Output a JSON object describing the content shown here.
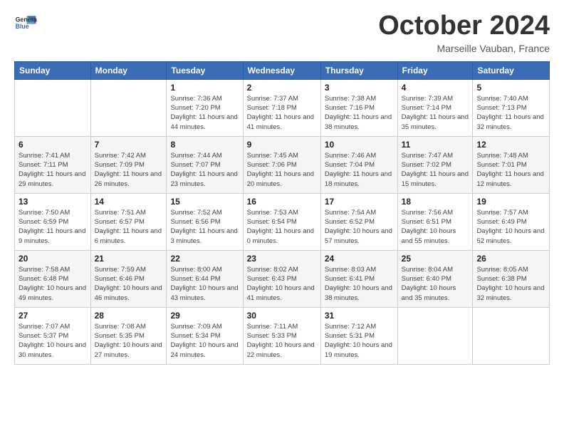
{
  "logo": {
    "line1": "General",
    "line2": "Blue"
  },
  "title": "October 2024",
  "location": "Marseille Vauban, France",
  "days_of_week": [
    "Sunday",
    "Monday",
    "Tuesday",
    "Wednesday",
    "Thursday",
    "Friday",
    "Saturday"
  ],
  "weeks": [
    [
      {
        "day": "",
        "sunrise": "",
        "sunset": "",
        "daylight": ""
      },
      {
        "day": "",
        "sunrise": "",
        "sunset": "",
        "daylight": ""
      },
      {
        "day": "1",
        "sunrise": "Sunrise: 7:36 AM",
        "sunset": "Sunset: 7:20 PM",
        "daylight": "Daylight: 11 hours and 44 minutes."
      },
      {
        "day": "2",
        "sunrise": "Sunrise: 7:37 AM",
        "sunset": "Sunset: 7:18 PM",
        "daylight": "Daylight: 11 hours and 41 minutes."
      },
      {
        "day": "3",
        "sunrise": "Sunrise: 7:38 AM",
        "sunset": "Sunset: 7:16 PM",
        "daylight": "Daylight: 11 hours and 38 minutes."
      },
      {
        "day": "4",
        "sunrise": "Sunrise: 7:39 AM",
        "sunset": "Sunset: 7:14 PM",
        "daylight": "Daylight: 11 hours and 35 minutes."
      },
      {
        "day": "5",
        "sunrise": "Sunrise: 7:40 AM",
        "sunset": "Sunset: 7:13 PM",
        "daylight": "Daylight: 11 hours and 32 minutes."
      }
    ],
    [
      {
        "day": "6",
        "sunrise": "Sunrise: 7:41 AM",
        "sunset": "Sunset: 7:11 PM",
        "daylight": "Daylight: 11 hours and 29 minutes."
      },
      {
        "day": "7",
        "sunrise": "Sunrise: 7:42 AM",
        "sunset": "Sunset: 7:09 PM",
        "daylight": "Daylight: 11 hours and 26 minutes."
      },
      {
        "day": "8",
        "sunrise": "Sunrise: 7:44 AM",
        "sunset": "Sunset: 7:07 PM",
        "daylight": "Daylight: 11 hours and 23 minutes."
      },
      {
        "day": "9",
        "sunrise": "Sunrise: 7:45 AM",
        "sunset": "Sunset: 7:06 PM",
        "daylight": "Daylight: 11 hours and 20 minutes."
      },
      {
        "day": "10",
        "sunrise": "Sunrise: 7:46 AM",
        "sunset": "Sunset: 7:04 PM",
        "daylight": "Daylight: 11 hours and 18 minutes."
      },
      {
        "day": "11",
        "sunrise": "Sunrise: 7:47 AM",
        "sunset": "Sunset: 7:02 PM",
        "daylight": "Daylight: 11 hours and 15 minutes."
      },
      {
        "day": "12",
        "sunrise": "Sunrise: 7:48 AM",
        "sunset": "Sunset: 7:01 PM",
        "daylight": "Daylight: 11 hours and 12 minutes."
      }
    ],
    [
      {
        "day": "13",
        "sunrise": "Sunrise: 7:50 AM",
        "sunset": "Sunset: 6:59 PM",
        "daylight": "Daylight: 11 hours and 9 minutes."
      },
      {
        "day": "14",
        "sunrise": "Sunrise: 7:51 AM",
        "sunset": "Sunset: 6:57 PM",
        "daylight": "Daylight: 11 hours and 6 minutes."
      },
      {
        "day": "15",
        "sunrise": "Sunrise: 7:52 AM",
        "sunset": "Sunset: 6:56 PM",
        "daylight": "Daylight: 11 hours and 3 minutes."
      },
      {
        "day": "16",
        "sunrise": "Sunrise: 7:53 AM",
        "sunset": "Sunset: 6:54 PM",
        "daylight": "Daylight: 11 hours and 0 minutes."
      },
      {
        "day": "17",
        "sunrise": "Sunrise: 7:54 AM",
        "sunset": "Sunset: 6:52 PM",
        "daylight": "Daylight: 10 hours and 57 minutes."
      },
      {
        "day": "18",
        "sunrise": "Sunrise: 7:56 AM",
        "sunset": "Sunset: 6:51 PM",
        "daylight": "Daylight: 10 hours and 55 minutes."
      },
      {
        "day": "19",
        "sunrise": "Sunrise: 7:57 AM",
        "sunset": "Sunset: 6:49 PM",
        "daylight": "Daylight: 10 hours and 52 minutes."
      }
    ],
    [
      {
        "day": "20",
        "sunrise": "Sunrise: 7:58 AM",
        "sunset": "Sunset: 6:48 PM",
        "daylight": "Daylight: 10 hours and 49 minutes."
      },
      {
        "day": "21",
        "sunrise": "Sunrise: 7:59 AM",
        "sunset": "Sunset: 6:46 PM",
        "daylight": "Daylight: 10 hours and 46 minutes."
      },
      {
        "day": "22",
        "sunrise": "Sunrise: 8:00 AM",
        "sunset": "Sunset: 6:44 PM",
        "daylight": "Daylight: 10 hours and 43 minutes."
      },
      {
        "day": "23",
        "sunrise": "Sunrise: 8:02 AM",
        "sunset": "Sunset: 6:43 PM",
        "daylight": "Daylight: 10 hours and 41 minutes."
      },
      {
        "day": "24",
        "sunrise": "Sunrise: 8:03 AM",
        "sunset": "Sunset: 6:41 PM",
        "daylight": "Daylight: 10 hours and 38 minutes."
      },
      {
        "day": "25",
        "sunrise": "Sunrise: 8:04 AM",
        "sunset": "Sunset: 6:40 PM",
        "daylight": "Daylight: 10 hours and 35 minutes."
      },
      {
        "day": "26",
        "sunrise": "Sunrise: 8:05 AM",
        "sunset": "Sunset: 6:38 PM",
        "daylight": "Daylight: 10 hours and 32 minutes."
      }
    ],
    [
      {
        "day": "27",
        "sunrise": "Sunrise: 7:07 AM",
        "sunset": "Sunset: 5:37 PM",
        "daylight": "Daylight: 10 hours and 30 minutes."
      },
      {
        "day": "28",
        "sunrise": "Sunrise: 7:08 AM",
        "sunset": "Sunset: 5:35 PM",
        "daylight": "Daylight: 10 hours and 27 minutes."
      },
      {
        "day": "29",
        "sunrise": "Sunrise: 7:09 AM",
        "sunset": "Sunset: 5:34 PM",
        "daylight": "Daylight: 10 hours and 24 minutes."
      },
      {
        "day": "30",
        "sunrise": "Sunrise: 7:11 AM",
        "sunset": "Sunset: 5:33 PM",
        "daylight": "Daylight: 10 hours and 22 minutes."
      },
      {
        "day": "31",
        "sunrise": "Sunrise: 7:12 AM",
        "sunset": "Sunset: 5:31 PM",
        "daylight": "Daylight: 10 hours and 19 minutes."
      },
      {
        "day": "",
        "sunrise": "",
        "sunset": "",
        "daylight": ""
      },
      {
        "day": "",
        "sunrise": "",
        "sunset": "",
        "daylight": ""
      }
    ]
  ]
}
